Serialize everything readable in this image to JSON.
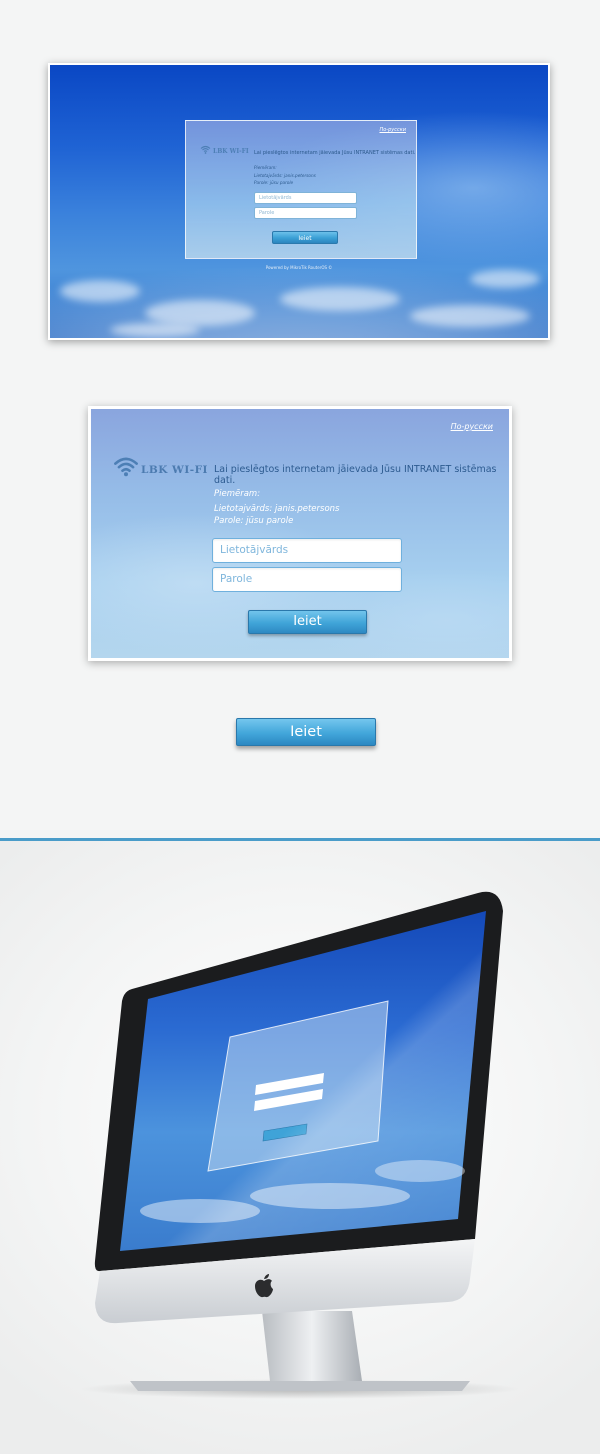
{
  "login": {
    "russian_link": "По-русски",
    "brand": "LBK WI-FI",
    "intro": "Lai pieslēgtos internetam jāievada Jūsu INTRANET sistēmas dati.",
    "example_title": "Piemēram:",
    "example_user": "Lietotajvārds: janis.petersons",
    "example_pass": "Parole: jūsu parole",
    "username_placeholder": "Lietotājvārds",
    "password_placeholder": "Parole",
    "submit_label": "Ieiet",
    "powered": "Powered by MikroTik RouterOS ©"
  },
  "colors": {
    "accent": "#42a6da",
    "divider": "#4a9cc9",
    "background": "#f4f5f5"
  },
  "icons": {
    "wifi": "wifi-icon",
    "apple": "apple-logo-icon"
  }
}
